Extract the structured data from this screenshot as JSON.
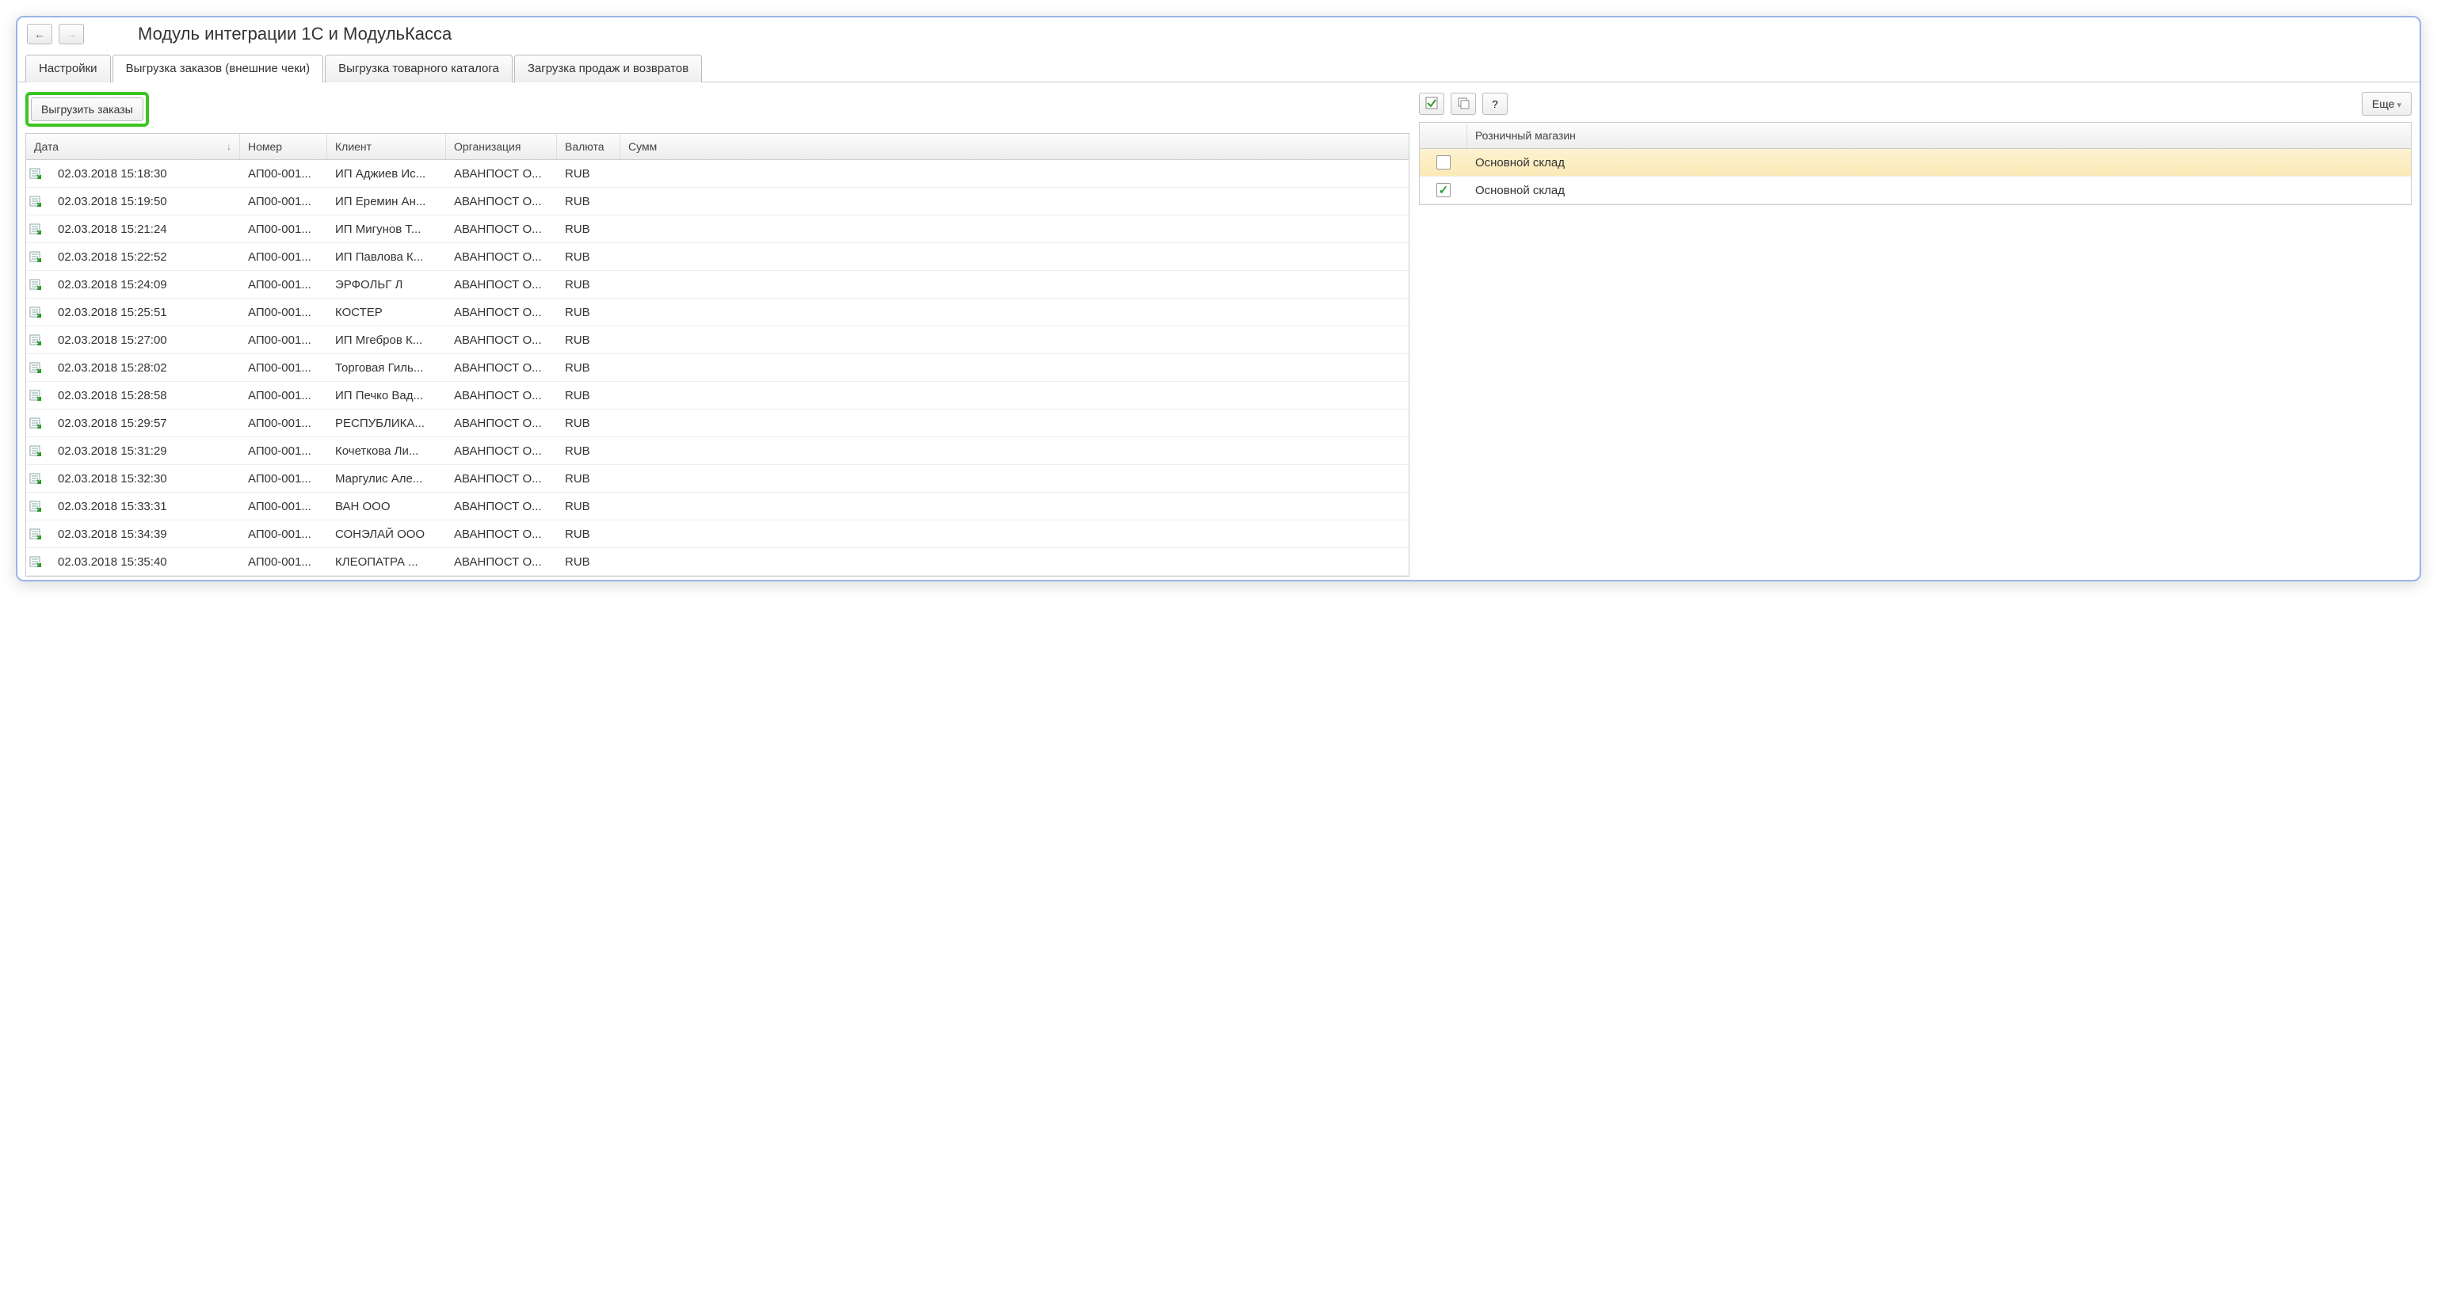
{
  "header": {
    "title": "Модуль интеграции 1С и МодульКасса"
  },
  "tabs": [
    {
      "label": "Настройки",
      "active": false
    },
    {
      "label": "Выгрузка заказов (внешние чеки)",
      "active": true
    },
    {
      "label": "Выгрузка товарного каталога",
      "active": false
    },
    {
      "label": "Загрузка продаж и возвратов",
      "active": false
    }
  ],
  "left": {
    "export_button": "Выгрузить заказы",
    "columns": {
      "date": "Дата",
      "number": "Номер",
      "client": "Клиент",
      "org": "Организация",
      "currency": "Валюта",
      "sum": "Сумм"
    },
    "rows": [
      {
        "date": "02.03.2018 15:18:30",
        "number": "АП00-001...",
        "client": "ИП Аджиев Ис...",
        "org": "АВАНПОСТ О...",
        "currency": "RUB"
      },
      {
        "date": "02.03.2018 15:19:50",
        "number": "АП00-001...",
        "client": "ИП Еремин Ан...",
        "org": "АВАНПОСТ О...",
        "currency": "RUB"
      },
      {
        "date": "02.03.2018 15:21:24",
        "number": "АП00-001...",
        "client": "ИП Мигунов Т...",
        "org": "АВАНПОСТ О...",
        "currency": "RUB"
      },
      {
        "date": "02.03.2018 15:22:52",
        "number": "АП00-001...",
        "client": "ИП Павлова К...",
        "org": "АВАНПОСТ О...",
        "currency": "RUB"
      },
      {
        "date": "02.03.2018 15:24:09",
        "number": "АП00-001...",
        "client": "ЭРФОЛЬГ Л",
        "org": "АВАНПОСТ О...",
        "currency": "RUB"
      },
      {
        "date": "02.03.2018 15:25:51",
        "number": "АП00-001...",
        "client": "КОСТЕР",
        "org": "АВАНПОСТ О...",
        "currency": "RUB"
      },
      {
        "date": "02.03.2018 15:27:00",
        "number": "АП00-001...",
        "client": "ИП Мгебров К...",
        "org": "АВАНПОСТ О...",
        "currency": "RUB"
      },
      {
        "date": "02.03.2018 15:28:02",
        "number": "АП00-001...",
        "client": "Торговая Гиль...",
        "org": "АВАНПОСТ О...",
        "currency": "RUB"
      },
      {
        "date": "02.03.2018 15:28:58",
        "number": "АП00-001...",
        "client": "ИП Печко Вад...",
        "org": "АВАНПОСТ О...",
        "currency": "RUB"
      },
      {
        "date": "02.03.2018 15:29:57",
        "number": "АП00-001...",
        "client": "РЕСПУБЛИКА...",
        "org": "АВАНПОСТ О...",
        "currency": "RUB"
      },
      {
        "date": "02.03.2018 15:31:29",
        "number": "АП00-001...",
        "client": "Кочеткова Ли...",
        "org": "АВАНПОСТ О...",
        "currency": "RUB"
      },
      {
        "date": "02.03.2018 15:32:30",
        "number": "АП00-001...",
        "client": "Маргулис Але...",
        "org": "АВАНПОСТ О...",
        "currency": "RUB"
      },
      {
        "date": "02.03.2018 15:33:31",
        "number": "АП00-001...",
        "client": "ВАН ООО",
        "org": "АВАНПОСТ О...",
        "currency": "RUB"
      },
      {
        "date": "02.03.2018 15:34:39",
        "number": "АП00-001...",
        "client": "СОНЭЛАЙ ООО",
        "org": "АВАНПОСТ О...",
        "currency": "RUB"
      },
      {
        "date": "02.03.2018 15:35:40",
        "number": "АП00-001...",
        "client": "КЛЕОПАТРА ...",
        "org": "АВАНПОСТ О...",
        "currency": "RUB"
      }
    ]
  },
  "right": {
    "more_button": "Еще",
    "help_label": "?",
    "columns": {
      "store": "Розничный магазин"
    },
    "rows": [
      {
        "checked": false,
        "name": "Основной склад",
        "selected": true
      },
      {
        "checked": true,
        "name": "Основной склад",
        "selected": false
      }
    ]
  }
}
